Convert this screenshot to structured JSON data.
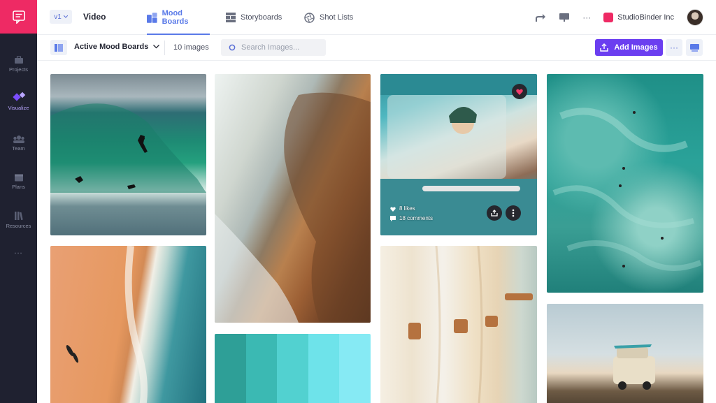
{
  "sidebar": {
    "items": [
      {
        "label": "Projects",
        "icon": "briefcase-icon"
      },
      {
        "label": "Visualize",
        "icon": "shapes-icon",
        "active": true
      },
      {
        "label": "Team",
        "icon": "team-icon"
      },
      {
        "label": "Plans",
        "icon": "calendar-icon"
      },
      {
        "label": "Resources",
        "icon": "books-icon"
      }
    ],
    "more": "..."
  },
  "topbar": {
    "version": "v1",
    "project_title": "Video",
    "tabs": [
      {
        "label": "Mood Boards",
        "active": true
      },
      {
        "label": "Storyboards"
      },
      {
        "label": "Shot Lists"
      }
    ],
    "more": "···",
    "org_name": "StudioBinder Inc"
  },
  "toolbar": {
    "board_select": "Active Mood Boards",
    "image_count": "10 images",
    "search_placeholder": "Search Images...",
    "add_images_label": "Add Images",
    "more": "···"
  },
  "cards": {
    "truck": {
      "likes": "8 likes",
      "comments": "18 comments"
    }
  },
  "palette": {
    "colors": [
      "#2e9f97",
      "#3bb9b3",
      "#52d1d0",
      "#6ee3ea",
      "#86eaf4"
    ]
  },
  "colors": {
    "accent": "#6b3ef0",
    "tab_active": "#5a7ae8",
    "sidebar_bg": "#1f2130",
    "brand": "#ee2a64"
  }
}
